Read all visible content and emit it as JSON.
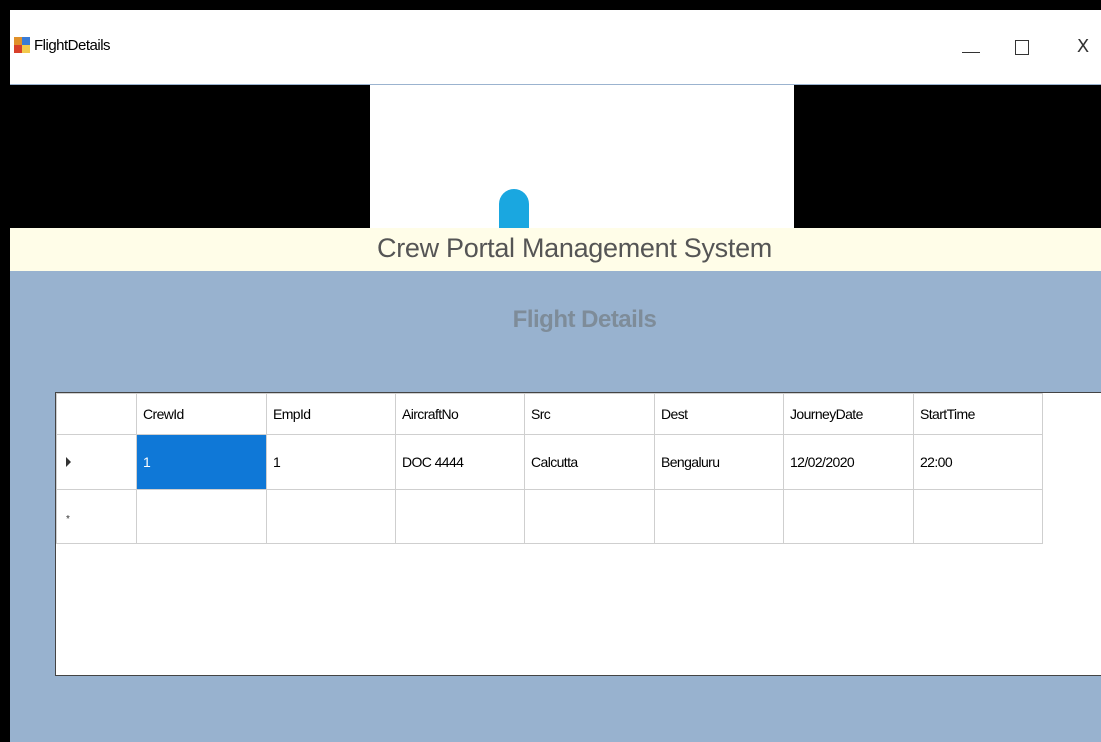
{
  "window": {
    "title": "FlightDetails",
    "controls": {
      "minimize": "—",
      "maximize": "☐",
      "close": "X"
    }
  },
  "header": {
    "system_title": "Crew Portal Management System"
  },
  "page": {
    "title": "Flight Details"
  },
  "grid": {
    "columns": [
      "CrewId",
      "EmpId",
      "AircraftNo",
      "Src",
      "Dest",
      "JourneyDate",
      "StartTime"
    ],
    "rows": [
      [
        "1",
        "1",
        "DOC 4444",
        "Calcutta",
        "Bengaluru",
        "12/02/2020",
        "22:00"
      ]
    ],
    "selected_cell": {
      "row": 0,
      "column": "CrewId"
    },
    "new_row_marker": "*"
  },
  "colors": {
    "background": "#98b2cf",
    "system_strip": "#fffde8",
    "selection": "#0f78d7",
    "header_dot": "#1aa7e0"
  }
}
